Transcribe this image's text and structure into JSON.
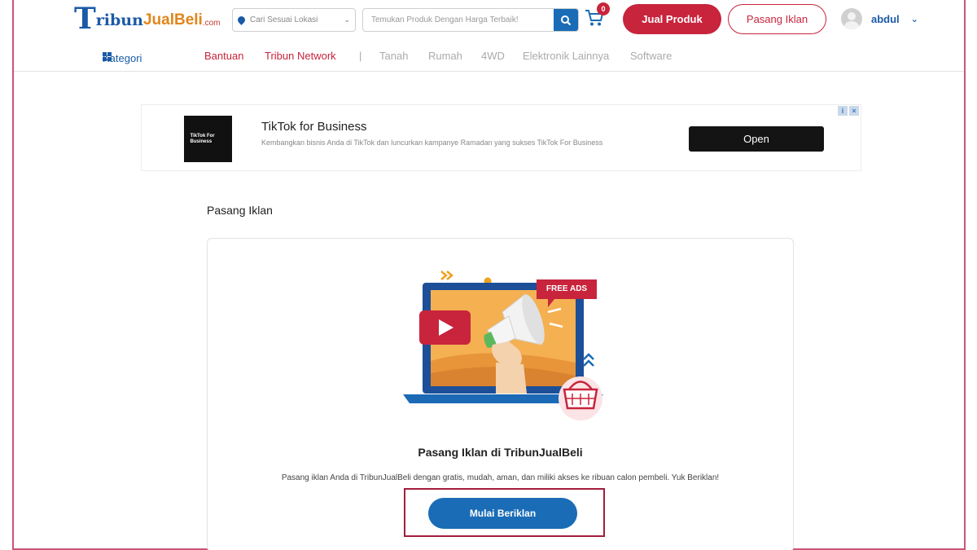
{
  "header": {
    "logo": {
      "part1": "T",
      "part2": "ribun",
      "part3": "JualBeli",
      "part4": ".com"
    },
    "location": {
      "placeholder": "Cari Sesuai Lokasi"
    },
    "search": {
      "placeholder": "Temukan Produk Dengan Harga Terbaik!"
    },
    "cart": {
      "count": "0"
    },
    "jual_button": "Jual Produk",
    "pasang_button": "Pasang Iklan",
    "user": {
      "name": "abdul"
    }
  },
  "nav": {
    "kategori": "Kategori",
    "links": [
      "Bantuan",
      "Tribun Network",
      "|",
      "Tanah",
      "Rumah",
      "4WD",
      "Elektronik Lainnya",
      "Software"
    ]
  },
  "ad": {
    "logo_text": "TikTok For Business",
    "title": "TikTok for Business",
    "description": "Kembangkan bisnis Anda di TikTok dan luncurkan kampanye Ramadan yang sukses TikTok For Business",
    "open_button": "Open"
  },
  "section_title": "Pasang Iklan",
  "card": {
    "badge": "FREE ADS",
    "title": "Pasang Iklan di TribunJualBeli",
    "description": "Pasang iklan Anda di TribunJualBeli dengan gratis, mudah, aman, dan miliki akses ke ribuan calon pembeli. Yuk Beriklan!",
    "cta": "Mulai Beriklan"
  },
  "colors": {
    "brand_blue": "#1a5aa6",
    "brand_red": "#c8243c",
    "cta_blue": "#1a6cb6"
  }
}
